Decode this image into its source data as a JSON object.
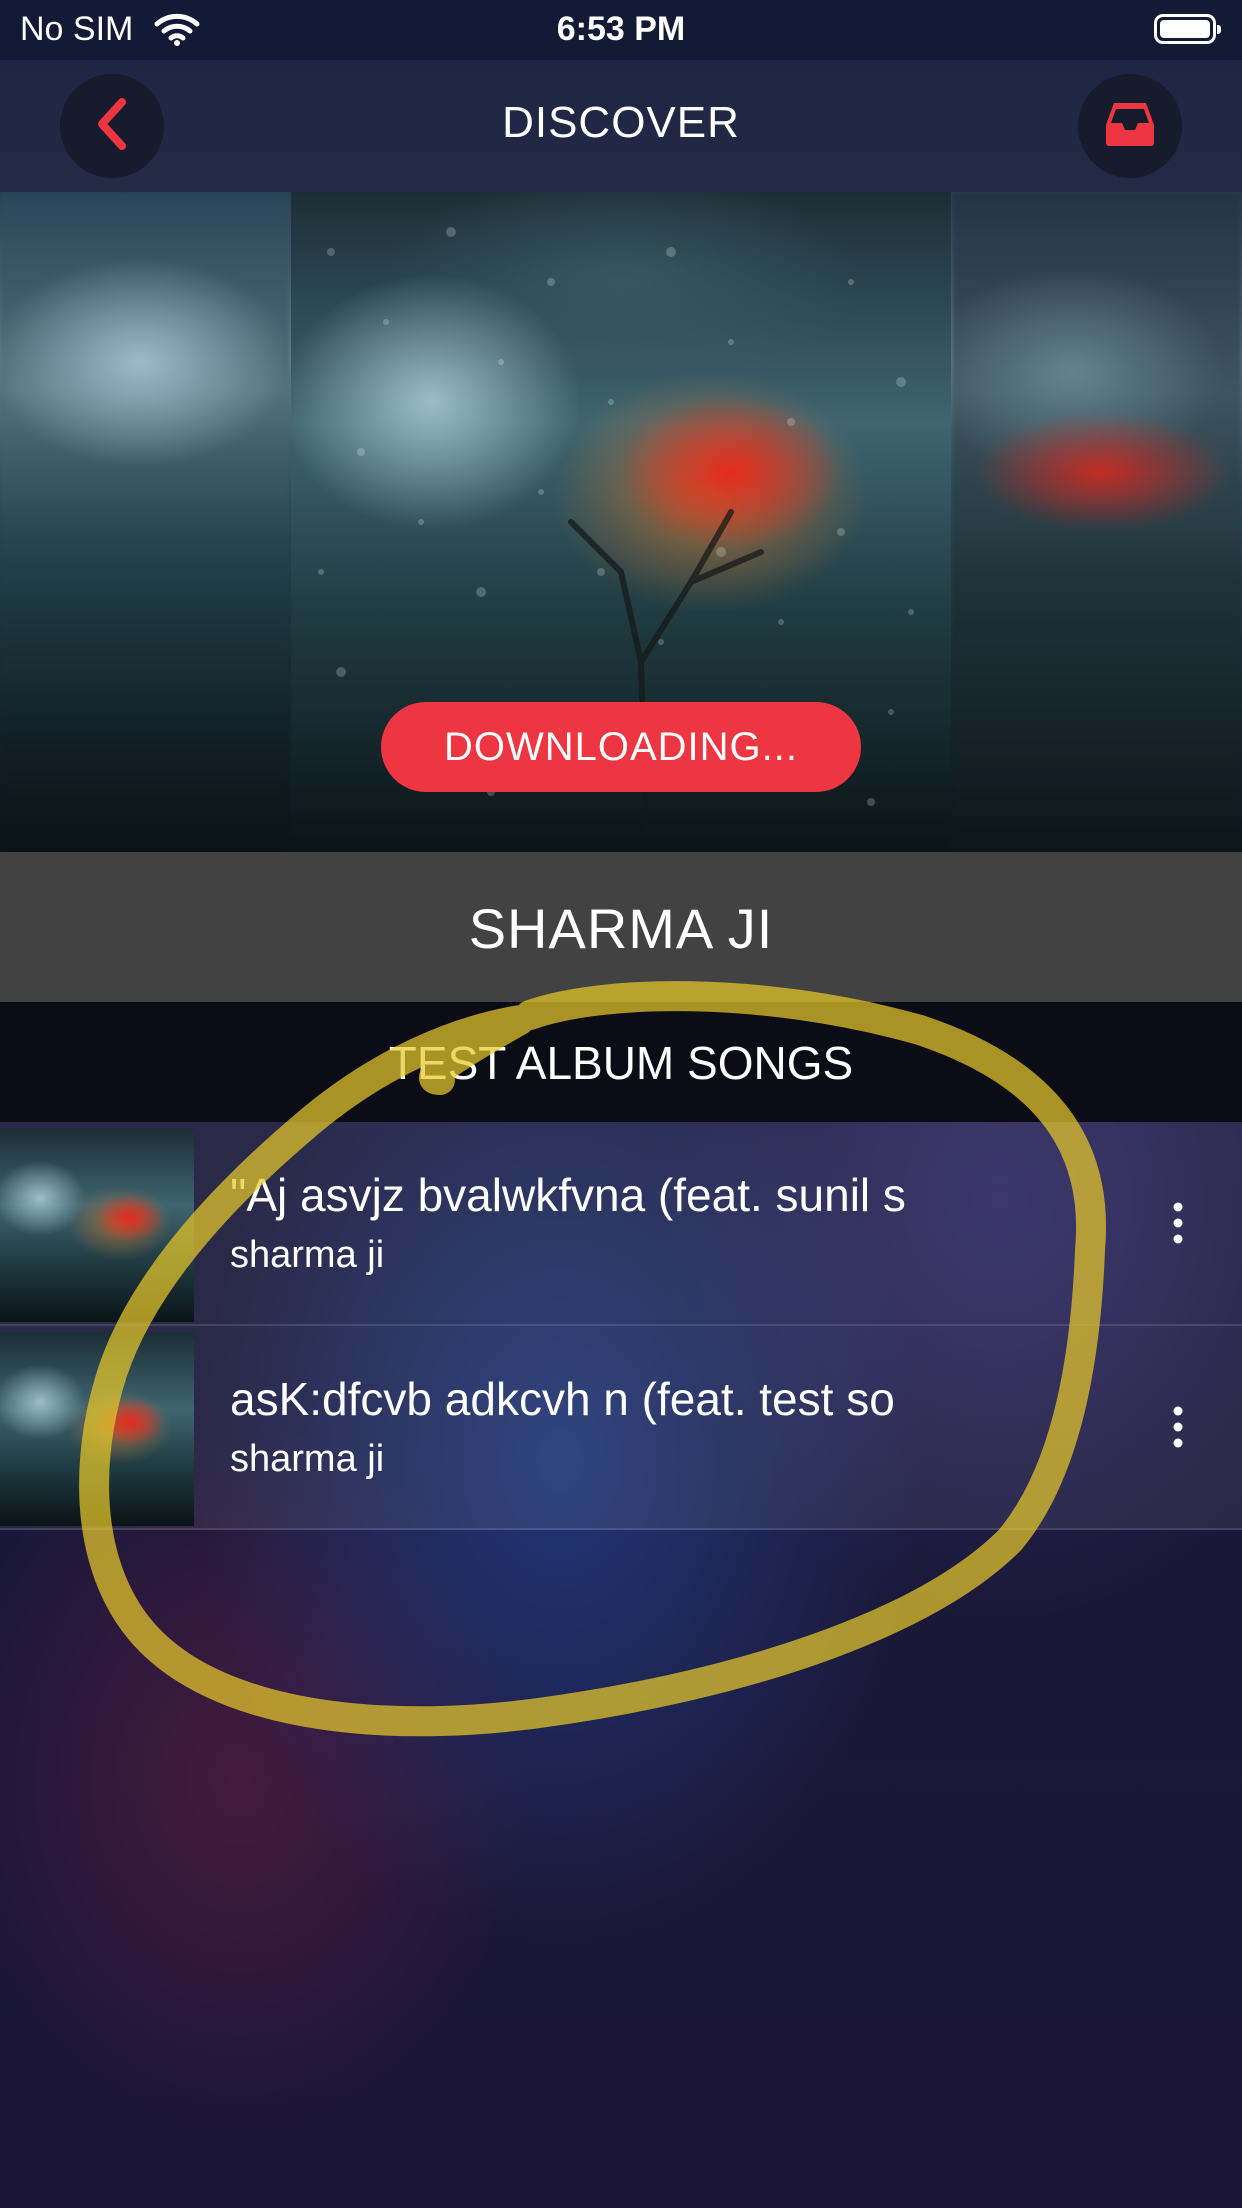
{
  "status_bar": {
    "carrier": "No SIM",
    "time": "6:53 PM"
  },
  "nav": {
    "title": "DISCOVER",
    "back_icon": "chevron-left-icon",
    "inbox_icon": "inbox-tray-icon"
  },
  "hero": {
    "download_button_label": "DOWNLOADING..."
  },
  "artist": {
    "name": "SHARMA JI"
  },
  "album": {
    "title": "TEST ALBUM SONGS"
  },
  "songs": [
    {
      "title": "\"Aj asvjz bvalwkfvna  (feat. sunil s",
      "artist": "sharma ji"
    },
    {
      "title": " asK:dfcvb adkcvh n (feat. test so",
      "artist": "sharma ji"
    }
  ],
  "colors": {
    "accent": "#ee3542",
    "highlight": "#e6c82a",
    "artist_bar": "#424242"
  }
}
